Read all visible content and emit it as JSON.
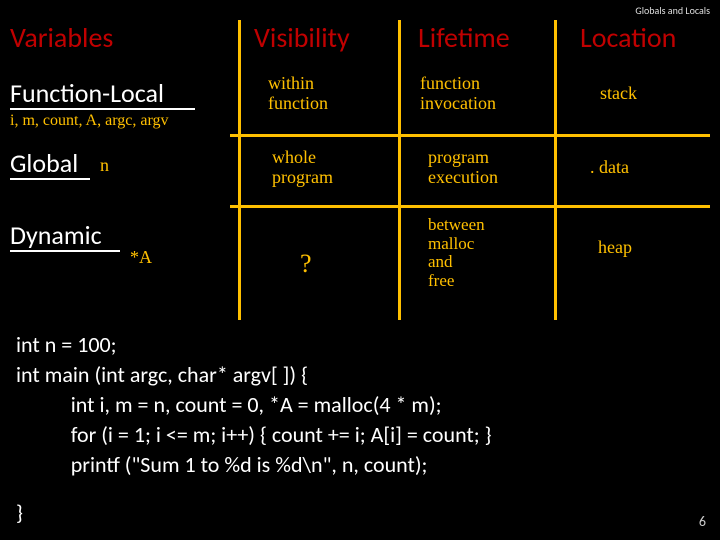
{
  "topic": "Globals and Locals",
  "headers": {
    "variables": "Variables",
    "visibility": "Visibility",
    "lifetime": "Lifetime",
    "location": "Location"
  },
  "rows": {
    "function_local": "Function-Local",
    "global": "Global",
    "dynamic": "Dynamic"
  },
  "annotations": {
    "fl_vars": "i, m, count, A, argc, argv",
    "fl_visibility": "within\nfunction",
    "fl_lifetime": "function\ninvocation",
    "fl_location": "stack",
    "g_vars": "n",
    "g_visibility": "whole\nprogram",
    "g_lifetime": "program\nexecution",
    "g_location": ". data",
    "d_vars": "*A",
    "d_visibility": "?",
    "d_lifetime": "between\nmalloc\nand\nfree",
    "d_location": "heap"
  },
  "code": {
    "l1": "int n = 100;",
    "l2": "int main (int argc, char* argv[ ]) {",
    "l3": "           int i, m = n, count = 0, *A = malloc(4 * m);",
    "l4": "           for (i = 1; i <= m; i++) { count += i; A[i] = count; }",
    "l5": "           printf (\"Sum 1 to %d is %d\\n\", n, count);",
    "l6": "}"
  },
  "slide_number": "6"
}
